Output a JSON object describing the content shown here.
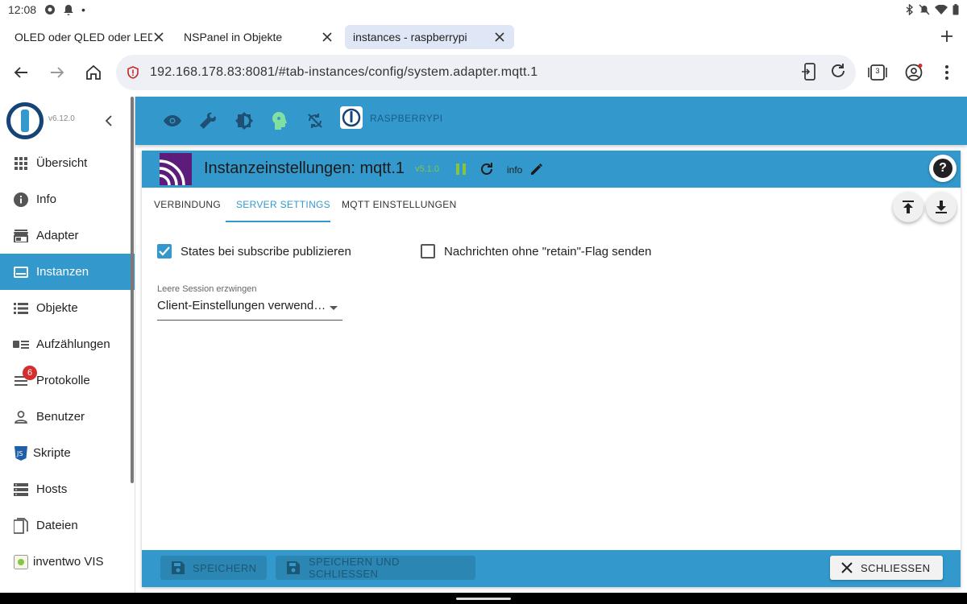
{
  "status_bar": {
    "time": "12:08",
    "dot": "•"
  },
  "browser": {
    "tabs": [
      {
        "label": "OLED oder QLED oder LED -",
        "active": false
      },
      {
        "label": "NSPanel in Objekte",
        "active": false
      },
      {
        "label": "instances - raspberrypi",
        "active": true
      }
    ],
    "url": "192.168.178.83:8081/#tab-instances/config/system.adapter.mqtt.1",
    "tab_count": "3"
  },
  "app": {
    "version": "v6.12.0",
    "host_name": "RASPBERRYPI",
    "colors": {
      "primary": "#3399cc",
      "active_bg": "#3399cc",
      "badge": "#d32f2f",
      "version_green": "#86c440"
    },
    "nav": [
      {
        "label": "Übersicht",
        "icon": "apps-grid-icon",
        "active": false
      },
      {
        "label": "Info",
        "icon": "info-icon",
        "active": false
      },
      {
        "label": "Adapter",
        "icon": "store-icon",
        "active": false
      },
      {
        "label": "Instanzen",
        "icon": "instances-icon",
        "active": true
      },
      {
        "label": "Objekte",
        "icon": "list-icon",
        "active": false
      },
      {
        "label": "Aufzählungen",
        "icon": "enum-icon",
        "active": false
      },
      {
        "label": "Protokolle",
        "icon": "log-icon",
        "active": false,
        "badge": "6"
      },
      {
        "label": "Benutzer",
        "icon": "user-icon",
        "active": false
      },
      {
        "label": "Skripte",
        "icon": "js-icon",
        "active": false
      },
      {
        "label": "Hosts",
        "icon": "hosts-icon",
        "active": false
      },
      {
        "label": "Dateien",
        "icon": "files-icon",
        "active": false
      },
      {
        "label": "inventwo VIS",
        "icon": "inventwo-icon",
        "active": false
      }
    ]
  },
  "dialog": {
    "title": "Instanzeinstellungen: mqtt.1",
    "version": "v5.1.0",
    "info_label": "info",
    "tabs": [
      {
        "label": "VERBINDUNG",
        "active": false
      },
      {
        "label": "SERVER SETTINGS",
        "active": true
      },
      {
        "label": "MQTT EINSTELLUNGEN",
        "active": false
      }
    ],
    "checkbox_publish": {
      "label": "States bei subscribe publizieren",
      "checked": true
    },
    "checkbox_retain": {
      "label": "Nachrichten ohne \"retain\"-Flag senden",
      "checked": false
    },
    "session_select": {
      "label": "Leere Session erzwingen",
      "value": "Client-Einstellungen verwend…"
    },
    "buttons": {
      "save": "SPEICHERN",
      "save_close": "SPEICHERN UND SCHLIESSEN",
      "close": "SCHLIESSEN"
    }
  }
}
